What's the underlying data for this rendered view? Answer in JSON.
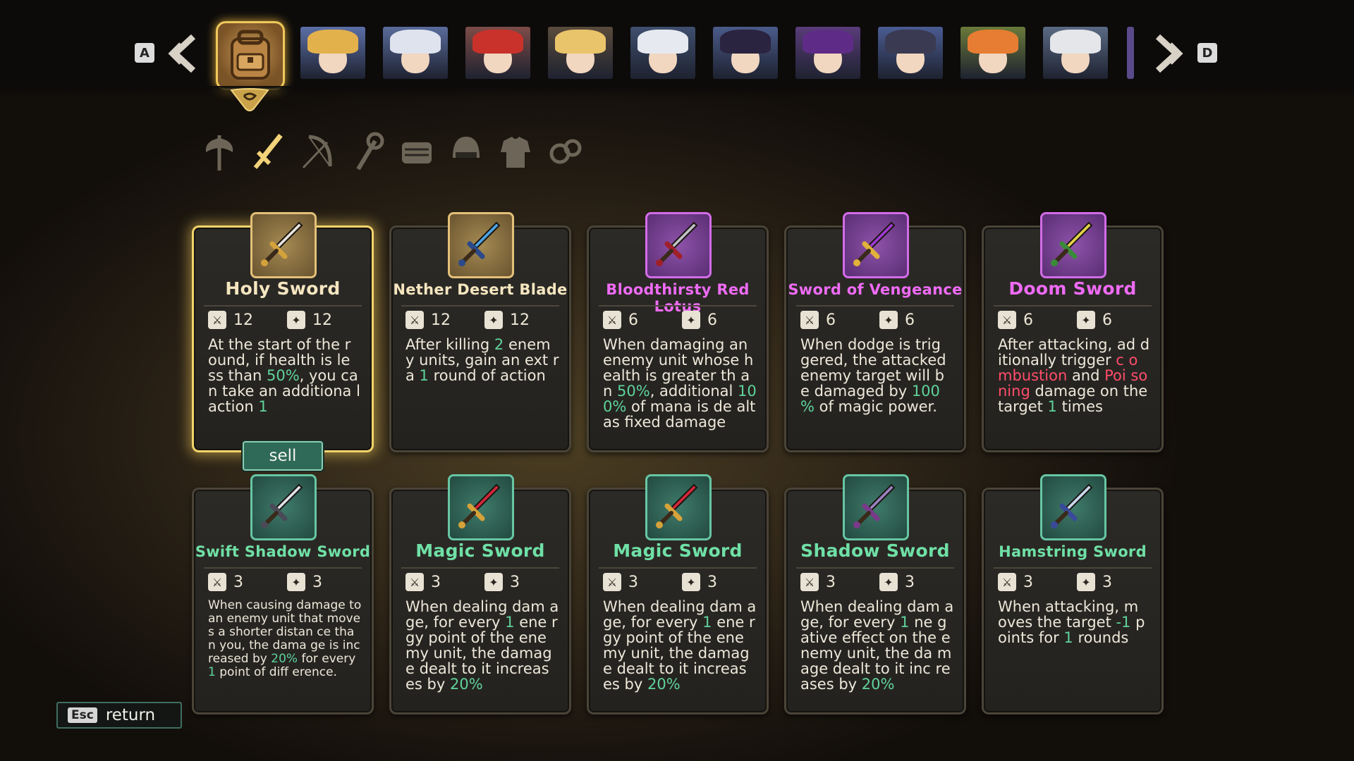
{
  "top_nav": {
    "prev_key": "A",
    "next_key": "D",
    "portraits": [
      {
        "id": "hero-1",
        "hair": "#e3b14c",
        "bg": "#5b6fa6"
      },
      {
        "id": "hero-2",
        "hair": "#dfe3ee",
        "bg": "#5a6c9b"
      },
      {
        "id": "hero-3",
        "hair": "#c9322a",
        "bg": "#7d4c48"
      },
      {
        "id": "hero-4",
        "hair": "#e9c46a",
        "bg": "#5a4b3c"
      },
      {
        "id": "hero-5",
        "hair": "#e7e9f0",
        "bg": "#3f4f6e"
      },
      {
        "id": "hero-6",
        "hair": "#2b2440",
        "bg": "#4a5b8a"
      },
      {
        "id": "hero-7",
        "hair": "#5e2c86",
        "bg": "#5a3c7a"
      },
      {
        "id": "hero-8",
        "hair": "#3a3a52",
        "bg": "#4a5c92"
      },
      {
        "id": "hero-9",
        "hair": "#e77d32",
        "bg": "#6a7a3a"
      },
      {
        "id": "hero-10",
        "hair": "#e4e6ea",
        "bg": "#5a6a84"
      }
    ]
  },
  "categories": [
    {
      "name": "axe",
      "active": false
    },
    {
      "name": "sword",
      "active": true
    },
    {
      "name": "bow",
      "active": false
    },
    {
      "name": "staff",
      "active": false
    },
    {
      "name": "scroll",
      "active": false
    },
    {
      "name": "helmet",
      "active": false
    },
    {
      "name": "armor",
      "active": false
    },
    {
      "name": "accessory",
      "active": false
    }
  ],
  "cards": [
    {
      "name": "Holy Sword",
      "rarity": "gold",
      "name_color": "#f5e6c0",
      "atk": "12",
      "spd": "12",
      "desc": [
        "At the start of the r ound, if health is le ss than ",
        {
          "t": "50%",
          "c": "g"
        },
        ", you ca n take an additiona l action ",
        {
          "t": "1",
          "c": "g"
        }
      ],
      "selected": true,
      "blade": "#e8e4da",
      "hilt": "#d3a23a"
    },
    {
      "name": "Nether Desert Blade",
      "rarity": "gold",
      "name_color": "#f5e6c0",
      "small": true,
      "atk": "12",
      "spd": "12",
      "desc": [
        "After killing ",
        {
          "t": "2",
          "c": "g"
        },
        " enem y units, gain an ext ra ",
        {
          "t": "1",
          "c": "g"
        },
        " round of action"
      ],
      "blade": "#4ca6e6",
      "hilt": "#2a4a8a"
    },
    {
      "name": "Bloodthirsty Red Lotus",
      "rarity": "purple",
      "name_color": "#ee6bf5",
      "small": true,
      "atk": "6",
      "spd": "6",
      "desc": [
        "When damaging an enemy unit whose health is greater th an ",
        {
          "t": "50%",
          "c": "g"
        },
        ", additional ",
        {
          "t": "100%",
          "c": "g"
        },
        " of mana is de alt as fixed damage"
      ],
      "blade": "#c2c2c8",
      "hilt": "#a0202a"
    },
    {
      "name": "Sword of Vengeance",
      "rarity": "purple",
      "name_color": "#ee6bf5",
      "small": true,
      "atk": "6",
      "spd": "6",
      "desc": [
        "When dodge is trig gered, the attacked enemy target will b e damaged by ",
        {
          "t": "100 %",
          "c": "g"
        },
        " of magic power."
      ],
      "blade": "#a23ad6",
      "hilt": "#e2b23a"
    },
    {
      "name": "Doom Sword",
      "rarity": "purple",
      "name_color": "#ee6bf5",
      "atk": "6",
      "spd": "6",
      "desc": [
        "After attacking, ad ditionally trigger ",
        {
          "t": "c ombustion",
          "c": "r"
        },
        " and ",
        {
          "t": "Poi soning",
          "c": "r"
        },
        " damage on the target ",
        {
          "t": "1",
          "c": "g"
        },
        " times"
      ],
      "blade": "#e6d24a",
      "hilt": "#3a8a3a"
    },
    {
      "name": "Swift Shadow Sword",
      "rarity": "green",
      "name_color": "#6fe0a6",
      "small": true,
      "atk": "3",
      "spd": "3",
      "tiny": true,
      "desc": [
        "When causing damage to an enemy unit that moves a shorter distan ce than you, the dama ge is increased by ",
        {
          "t": "20%",
          "c": "g"
        },
        " for every ",
        {
          "t": "1",
          "c": "g"
        },
        " point of diff erence."
      ],
      "blade": "#e0e2e8",
      "hilt": "#4a4a58"
    },
    {
      "name": "Magic Sword",
      "rarity": "green",
      "name_color": "#6fe0a6",
      "atk": "3",
      "spd": "3",
      "desc": [
        "When dealing dam age, for every ",
        {
          "t": "1",
          "c": "g"
        },
        " ene rgy point of the ene my unit, the damag e dealt to it increas es by ",
        {
          "t": "20%",
          "c": "g"
        }
      ],
      "blade": "#d4283a",
      "hilt": "#d6a23a"
    },
    {
      "name": "Magic Sword",
      "rarity": "green",
      "name_color": "#6fe0a6",
      "atk": "3",
      "spd": "3",
      "desc": [
        "When dealing dam age, for every ",
        {
          "t": "1",
          "c": "g"
        },
        " ene rgy point of the ene my unit, the damag e dealt to it increas es by ",
        {
          "t": "20%",
          "c": "g"
        }
      ],
      "blade": "#d4283a",
      "hilt": "#d6a23a"
    },
    {
      "name": "Shadow Sword",
      "rarity": "green",
      "name_color": "#6fe0a6",
      "atk": "3",
      "spd": "3",
      "desc": [
        "When dealing dam age, for every ",
        {
          "t": "1",
          "c": "g"
        },
        " ne gative effect on the enemy unit, the da mage dealt to it inc reases by ",
        {
          "t": "20%",
          "c": "g"
        }
      ],
      "blade": "#9a82c2",
      "hilt": "#7a3a8a"
    },
    {
      "name": "Hamstring Sword",
      "rarity": "green",
      "name_color": "#6fe0a6",
      "small": true,
      "atk": "3",
      "spd": "3",
      "desc": [
        "When attacking, m oves the target ",
        {
          "t": "-1",
          "c": "g"
        },
        " p oints for ",
        {
          "t": "1",
          "c": "g"
        },
        " rounds"
      ],
      "blade": "#c8d8f0",
      "hilt": "#3a4a9a"
    }
  ],
  "sell_label": "sell",
  "return": {
    "key": "Esc",
    "label": "return"
  }
}
